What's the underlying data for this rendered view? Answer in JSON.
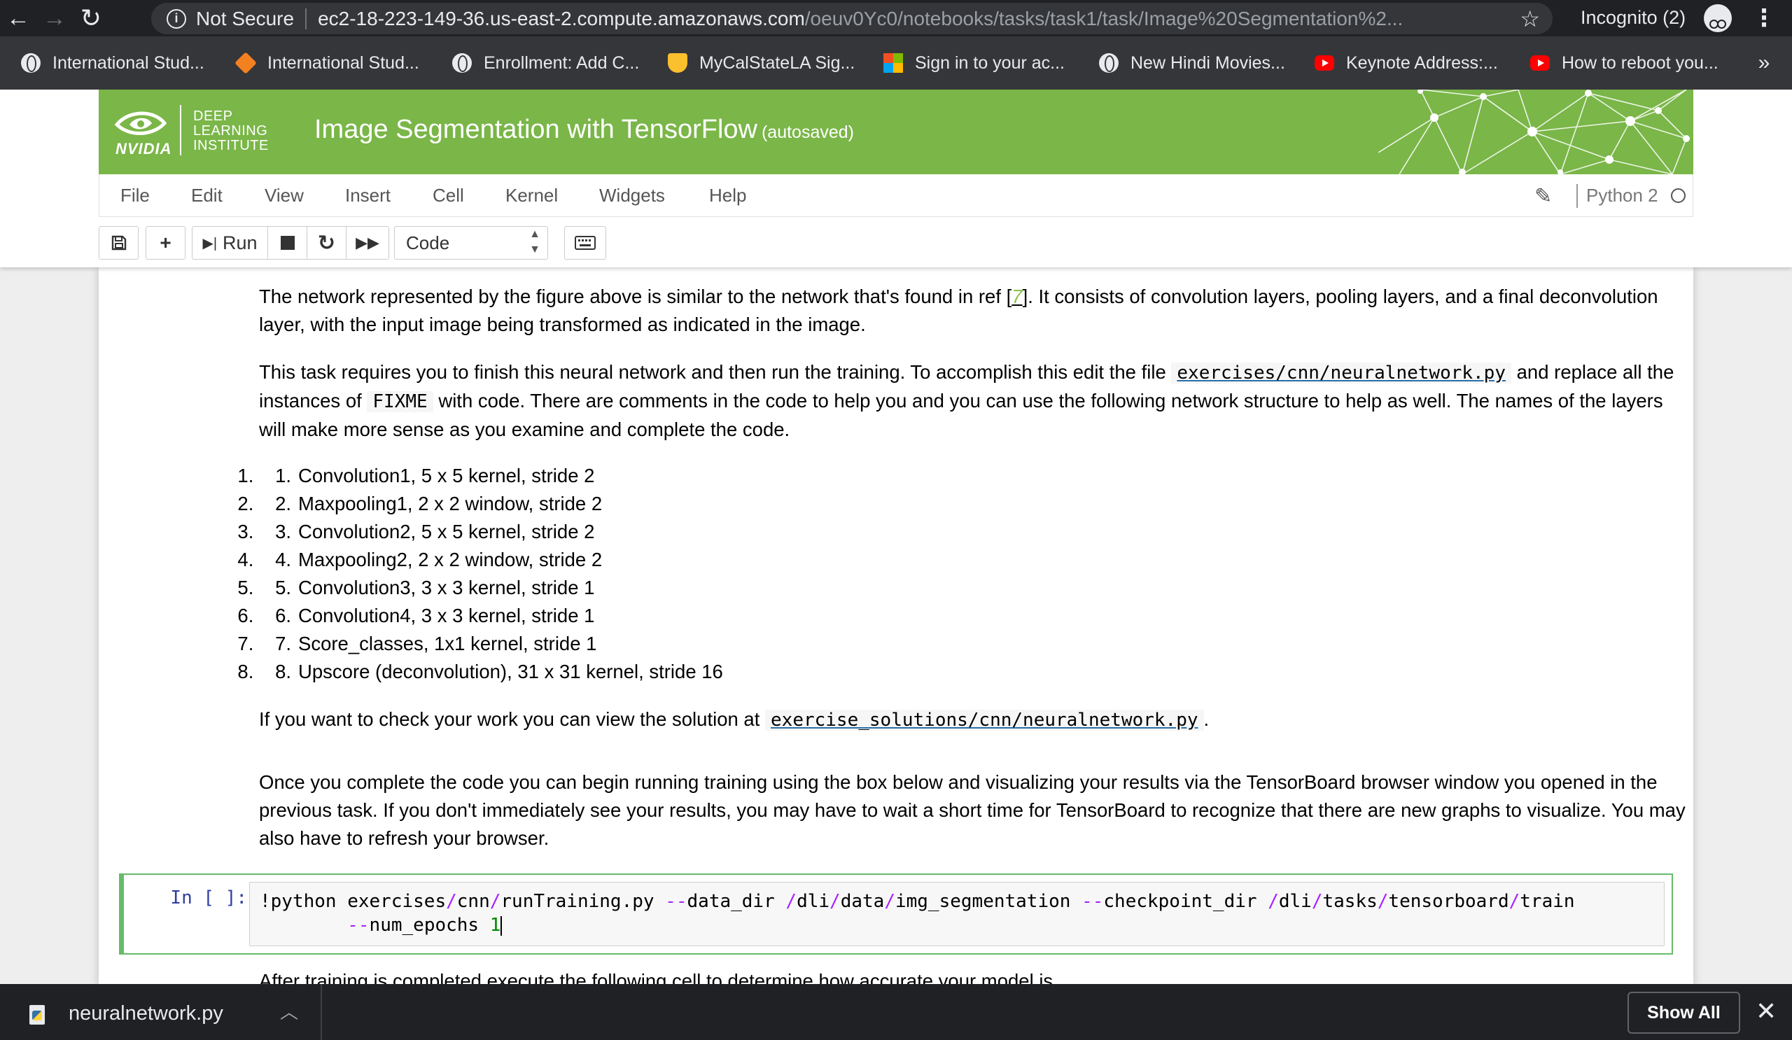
{
  "browser": {
    "omnibox": {
      "security_label": "Not Secure",
      "host": "ec2-18-223-149-36.us-east-2.compute.amazonaws.com",
      "path": "/oeuv0Yc0/notebooks/tasks/task1/task/Image%20Segmentation%2..."
    },
    "profile": "Incognito (2)",
    "bookmarks": [
      {
        "label": "International Stud...",
        "icon": "globe-icon"
      },
      {
        "label": "International Stud...",
        "icon": "diamond-logo-icon"
      },
      {
        "label": "Enrollment: Add C...",
        "icon": "globe-icon"
      },
      {
        "label": "MyCalStateLA Sig...",
        "icon": "shield-logo-icon"
      },
      {
        "label": "Sign in to your ac...",
        "icon": "microsoft-logo-icon"
      },
      {
        "label": "New Hindi Movies...",
        "icon": "globe-icon"
      },
      {
        "label": "Keynote Address:...",
        "icon": "youtube-icon"
      },
      {
        "label": "How to reboot you...",
        "icon": "youtube-icon"
      }
    ],
    "more_bookmarks": "»"
  },
  "jupyter": {
    "logo": {
      "brand": "NVIDIA",
      "line1": "DEEP",
      "line2": "LEARNING",
      "line3": "INSTITUTE"
    },
    "title": "Image Segmentation with TensorFlow",
    "save_status": "(autosaved)",
    "menu": [
      "File",
      "Edit",
      "View",
      "Insert",
      "Cell",
      "Kernel",
      "Widgets",
      "Help"
    ],
    "kernel": "Python 2",
    "toolbar": {
      "run_label": "Run",
      "cell_type": "Code"
    },
    "accent_color": "#7ab648"
  },
  "notebook": {
    "p1": {
      "before": "The network represented by the figure above is similar to the network that's found in ref [",
      "ref": "7",
      "after": "]. It consists of convolution layers, pooling layers, and a final deconvolution layer, with the input image being transformed as indicated in the image."
    },
    "p2": {
      "part1": "This task requires you to finish this neural network and then run the training. To accomplish this edit the file ",
      "file": "exercises/cnn/neuralnetwork.py",
      "part2": " and replace all the instances of ",
      "fixme": "FIXME",
      "part3": " with code. There are comments in the code to help you and you can use the following network structure to help as well. The names of the layers will make more sense as you examine and complete the code."
    },
    "layers": [
      "Convolution1, 5 x 5 kernel, stride 2",
      "Maxpooling1, 2 x 2 window, stride 2",
      "Convolution2, 5 x 5 kernel, stride 2",
      "Maxpooling2, 2 x 2 window, stride 2",
      "Convolution3, 3 x 3 kernel, stride 1",
      "Convolution4, 3 x 3 kernel, stride 1",
      "Score_classes, 1x1 kernel, stride 1",
      "Upscore (deconvolution), 31 x 31 kernel, stride 16"
    ],
    "p3": {
      "before": "If you want to check your work you can view the solution at ",
      "file": "exercise_solutions/cnn/neuralnetwork.py",
      "after": "."
    },
    "p4": "Once you complete the code you can begin running training using the box below and visualizing your results via the TensorBoard browser window you opened in the previous task. If you don't immediately see your results, you may have to wait a short time for TensorBoard to recognize that there are new graphs to visualize. You may also have to refresh your browser.",
    "code_cell": {
      "prompt": "In [ ]:",
      "tokens": [
        {
          "t": "!python exercises",
          "c": ""
        },
        {
          "t": "/",
          "c": "op"
        },
        {
          "t": "cnn",
          "c": ""
        },
        {
          "t": "/",
          "c": "op"
        },
        {
          "t": "runTraining.py ",
          "c": ""
        },
        {
          "t": "--",
          "c": "op"
        },
        {
          "t": "data_dir ",
          "c": ""
        },
        {
          "t": "/",
          "c": "op"
        },
        {
          "t": "dli",
          "c": ""
        },
        {
          "t": "/",
          "c": "op"
        },
        {
          "t": "data",
          "c": ""
        },
        {
          "t": "/",
          "c": "op"
        },
        {
          "t": "img_segmentation ",
          "c": ""
        },
        {
          "t": "--",
          "c": "op"
        },
        {
          "t": "checkpoint_dir ",
          "c": ""
        },
        {
          "t": "/",
          "c": "op"
        },
        {
          "t": "dli",
          "c": ""
        },
        {
          "t": "/",
          "c": "op"
        },
        {
          "t": "tasks",
          "c": ""
        },
        {
          "t": "/",
          "c": "op"
        },
        {
          "t": "tensorboard",
          "c": ""
        },
        {
          "t": "/",
          "c": "op"
        },
        {
          "t": "train",
          "c": ""
        }
      ],
      "line2_indent": "        ",
      "line2_op": "--",
      "line2_name": "num_epochs ",
      "line2_value": "1"
    },
    "next_text_cut": "After training is completed execute the following cell to determine how accurate your model is."
  },
  "downloads": {
    "file": "neuralnetwork.py",
    "show_all": "Show All"
  }
}
